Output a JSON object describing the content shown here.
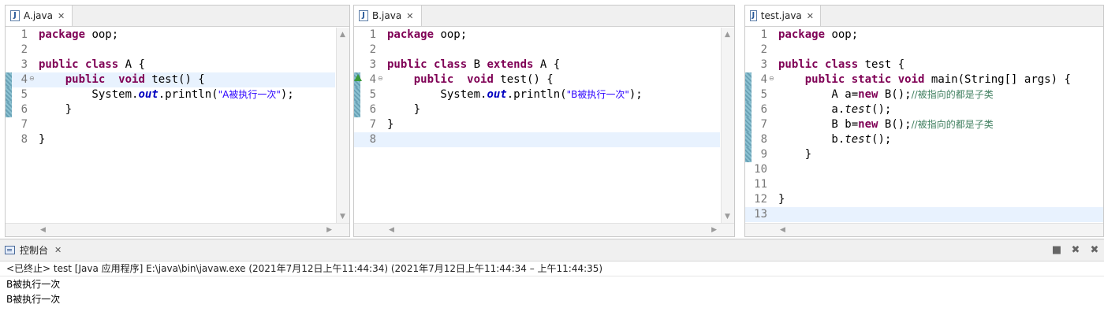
{
  "editors": [
    {
      "tab": "A.java",
      "lines": [
        "package oop;",
        "",
        "public class A {",
        "public void test() {",
        "System.out.println(\"A被执行一次\");",
        "}",
        "",
        "}"
      ]
    },
    {
      "tab": "B.java",
      "lines": [
        "package oop;",
        "",
        "public class B extends A {",
        "public void test() {",
        "System.out.println(\"B被执行一次\");",
        "}",
        "}",
        ""
      ]
    },
    {
      "tab": "test.java",
      "lines": [
        "package oop;",
        "",
        "public class test {",
        "public static void main(String[] args) {",
        "A a=new B();//被指向的都是子类",
        "a.test();",
        "B b=new B();//被指向的都是子类",
        "b.test();",
        "}",
        "",
        "",
        "}",
        ""
      ]
    }
  ],
  "console": {
    "tab": "控制台",
    "status": "<已终止> test [Java 应用程序] E:\\java\\bin\\javaw.exe  (2021年7月12日上午11:44:34)   (2021年7月12日上午11:44:34 – 上午11:44:35)",
    "output": [
      "B被执行一次",
      "B被执行一次"
    ]
  },
  "icons": {
    "file": "java-file-icon",
    "close": "close-icon",
    "console": "console-icon",
    "terminate": "terminate-icon",
    "remove": "remove-launch-icon",
    "remove_all": "remove-all-icon"
  },
  "colors": {
    "keyword": "#7f0055",
    "string": "#2a00ff",
    "comment": "#3f7f5f",
    "field": "#0000c0",
    "current_line": "#e8f2fe"
  }
}
